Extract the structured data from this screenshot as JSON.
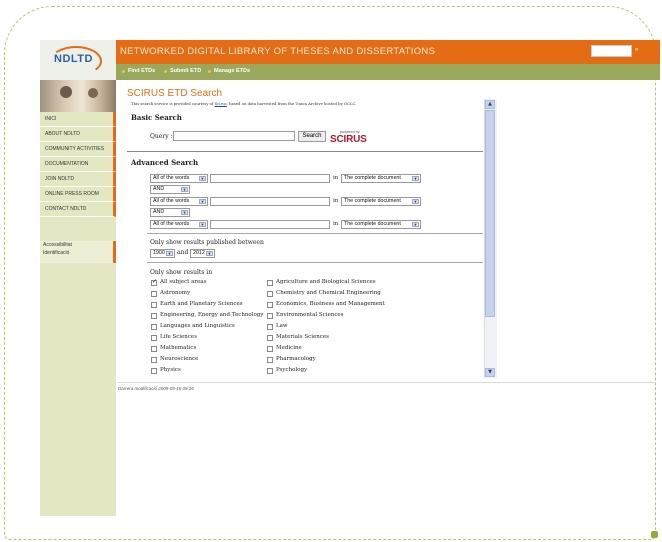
{
  "header": {
    "logo": "NDLTD",
    "site_title": "NETWORKED DIGITAL LIBRARY OF THESES AND DISSERTATIONS",
    "search_go": "»"
  },
  "nav": [
    {
      "label": "Find ETDs"
    },
    {
      "label": "Submit ETD"
    },
    {
      "label": "Manage ETDs"
    }
  ],
  "sidebar": {
    "items": [
      {
        "label": "INICI"
      },
      {
        "label": "ABOUT NDLTD"
      },
      {
        "label": "COMMUNITY ACTIVITIES"
      },
      {
        "label": "DOCUMENTATION"
      },
      {
        "label": "JOIN NDLTD"
      },
      {
        "label": "ONLINE PRESS ROOM"
      },
      {
        "label": "CONTACT NDLTD"
      }
    ],
    "extra": [
      "Accessibilitat",
      "Identificació"
    ]
  },
  "content": {
    "title": "SCIRUS ETD Search",
    "courtesy_pre": "This search service is provided courtesy of ",
    "courtesy_link": "Scirus",
    "courtesy_post": ", based on data harvested from the Union Archive hosted by OCLC.",
    "basic_heading": "Basic Search",
    "query_label": "Query :",
    "search_button": "Search",
    "powered_by": "powered by",
    "scirus_logo": "SCIRUS",
    "advanced_heading": "Advanced Search",
    "rows": [
      {
        "match": "All of the words",
        "in_label": "in",
        "field": "The complete document"
      },
      {
        "match": "All of the words",
        "in_label": "in",
        "field": "The complete document"
      },
      {
        "match": "All of the words",
        "in_label": "in",
        "field": "The complete document"
      }
    ],
    "operators": [
      "AND",
      "AND"
    ],
    "published_label": "Only show results published between",
    "year_from": "1900",
    "year_and": "and",
    "year_to": "2012",
    "subjects_label": "Only show results in",
    "subjects_left": [
      {
        "label": "All subject areas",
        "checked": true
      },
      {
        "label": "Astronomy",
        "checked": false
      },
      {
        "label": "Earth and Planetary Sciences",
        "checked": false
      },
      {
        "label": "Engineering, Energy and Technology",
        "checked": false
      },
      {
        "label": "Languages and Linguistics",
        "checked": false
      },
      {
        "label": "Life Sciences",
        "checked": false
      },
      {
        "label": "Mathematics",
        "checked": false
      },
      {
        "label": "Neuroscience",
        "checked": false
      },
      {
        "label": "Physics",
        "checked": false
      }
    ],
    "subjects_right": [
      {
        "label": "Agriculture and Biological Sciences",
        "checked": false
      },
      {
        "label": "Chemistry and Chemical Engineering",
        "checked": false
      },
      {
        "label": "Economics, Business and Management",
        "checked": false
      },
      {
        "label": "Environmental Sciences",
        "checked": false
      },
      {
        "label": "Law",
        "checked": false
      },
      {
        "label": "Materials Sciences",
        "checked": false
      },
      {
        "label": "Medicine",
        "checked": false
      },
      {
        "label": "Pharmacology",
        "checked": false
      },
      {
        "label": "Psychology",
        "checked": false
      }
    ]
  },
  "footer": {
    "modified": "Darrera modificació 2009-09-15 09:26"
  },
  "colors": {
    "brand_orange": "#e46c14",
    "nav_green": "#9aa85c",
    "sidebar_bg": "#e3e8c3",
    "scirus_red": "#b01a2e"
  }
}
